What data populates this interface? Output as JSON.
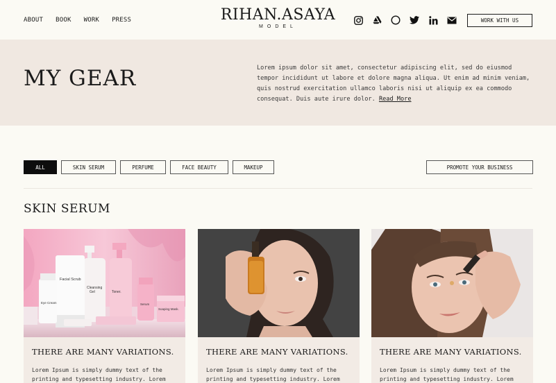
{
  "nav": {
    "items": [
      "ABOUT",
      "BOOK",
      "WORK",
      "PRESS"
    ]
  },
  "logo": {
    "name": "RIHAN.ASAYA",
    "subtitle": "MODEL"
  },
  "socials": [
    "instagram-icon",
    "artstation-icon",
    "circle-icon",
    "twitter-icon",
    "linkedin-icon",
    "mail-icon"
  ],
  "header": {
    "work_button": "WORK WITH US"
  },
  "hero": {
    "title": "MY GEAR",
    "text": "Lorem ipsum dolor sit amet, consectetur adipiscing elit, sed do eiusmod tempor incididunt ut labore et dolore magna aliqua. Ut enim ad minim veniam, quis nostrud exercitation ullamco laboris nisi ut aliquip ex ea commodo consequat. Duis aute irure dolor.",
    "read_more": "Read More"
  },
  "filters": [
    "ALL",
    "SKIN SERUM",
    "PERFUME",
    "FACE BEAUTY",
    "MAKEUP"
  ],
  "promote_button": "PROMOTE YOUR BUSINESS",
  "section": {
    "title": "SKIN SERUM"
  },
  "cards": [
    {
      "title": "THERE ARE MANY VARIATIONS.",
      "desc": "Lorem Ipsum is simply dummy text of the printing and typesetting industry. Lorem Ipsum"
    },
    {
      "title": "THERE ARE MANY VARIATIONS.",
      "desc": "Lorem Ipsum is simply dummy text of the printing and typesetting industry. Lorem Ipsum"
    },
    {
      "title": "THERE ARE MANY VARIATIONS.",
      "desc": "Lorem Ipsum is simply dummy text of the printing and typesetting industry. Lorem Ipsum"
    }
  ],
  "product_labels": [
    "Facial Scrub",
    "Cleansing Gel",
    "Toner.",
    "Eye Cream",
    "Serum",
    "Soaping Mask."
  ],
  "colors": {
    "background": "#fbfaf4",
    "hero_bg": "#f0e8e1",
    "card_bg": "#f2ebe5",
    "active_filter": "#0d0d0d"
  }
}
